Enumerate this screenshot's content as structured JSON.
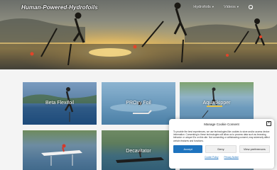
{
  "header": {
    "site_title": "Human-Powered-Hydrofoils",
    "nav": [
      {
        "label": "Hydrofoils",
        "has_dropdown": true
      },
      {
        "label": "Videos",
        "has_dropdown": true
      }
    ],
    "search_icon": "search-icon"
  },
  "cards": [
    {
      "title": "Beta Flexifoil"
    },
    {
      "title": "PROxy Foil"
    },
    {
      "title": "Aquaskipper"
    },
    {
      "title": ""
    },
    {
      "title": "Decavitator"
    },
    {
      "title": ""
    }
  ],
  "cookie": {
    "title": "Manage Cookie Consent",
    "text": "To provide the best experiences, we use technologies like cookies to store and/or access device information. Consenting to these technologies will allow us to process data such as browsing behavior or unique IDs on this site. Not consenting or withdrawing consent, may adversely affect certain features and functions.",
    "accept_label": "Accept",
    "deny_label": "Deny",
    "preferences_label": "View preferences",
    "cookie_policy_label": "Cookie Policy",
    "privacy_label": "Privacy Notice"
  },
  "colors": {
    "accent": "#1e73be"
  }
}
